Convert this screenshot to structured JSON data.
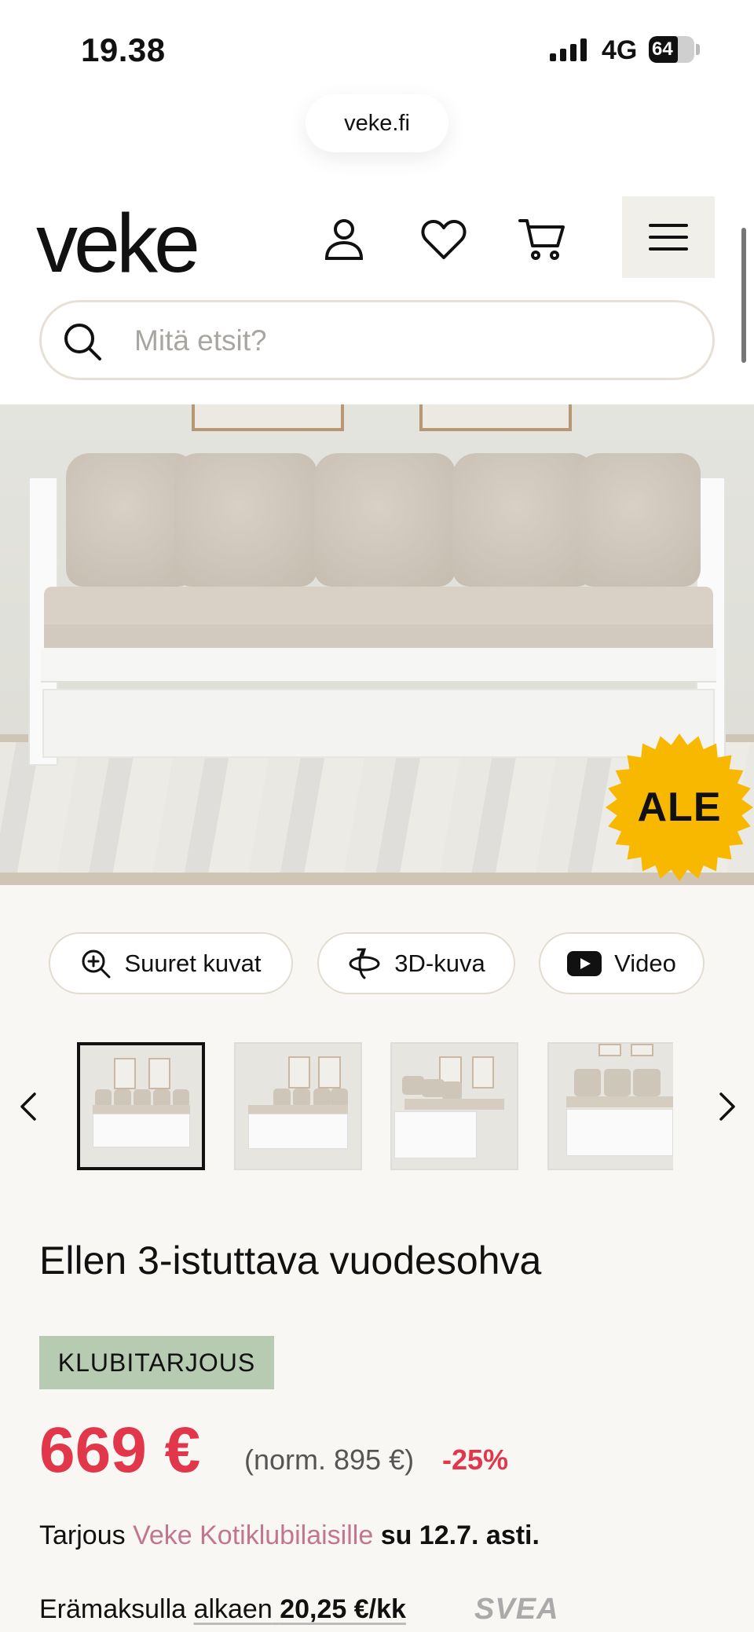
{
  "status_bar": {
    "time": "19.38",
    "network": "4G",
    "battery": "64",
    "battery_level": 0.64
  },
  "browser": {
    "url": "veke.fi"
  },
  "header": {
    "logo": "veke",
    "icons": [
      "user-icon",
      "heart-icon",
      "cart-icon",
      "menu-icon"
    ],
    "search_placeholder": "Mitä etsit?"
  },
  "hero": {
    "sale_badge": "ALE",
    "badge_color": "#f8b800"
  },
  "media_buttons": {
    "large_images": "Suuret kuvat",
    "view_3d": "3D-kuva",
    "video": "Video"
  },
  "gallery": {
    "thumbnail_count": 4,
    "active_index": 0
  },
  "product": {
    "title": "Ellen 3-istuttava vuodesohva",
    "badge": "KLUBITARJOUS",
    "price": "669 €",
    "normal_price": "(norm. 895 €)",
    "discount": "-25%",
    "offer_prefix": "Tarjous",
    "offer_link": "Veke Kotiklubilaisille",
    "offer_date": "su 12.7. asti.",
    "installment_prefix": "Erämaksulla",
    "installment_from": "alkaen",
    "installment_amount": "20,25 €/kk",
    "installment_provider": "SVEA"
  },
  "colors": {
    "price_red": "#e2374b",
    "badge_green": "#b7cbb2",
    "link_pink": "#c27591"
  }
}
